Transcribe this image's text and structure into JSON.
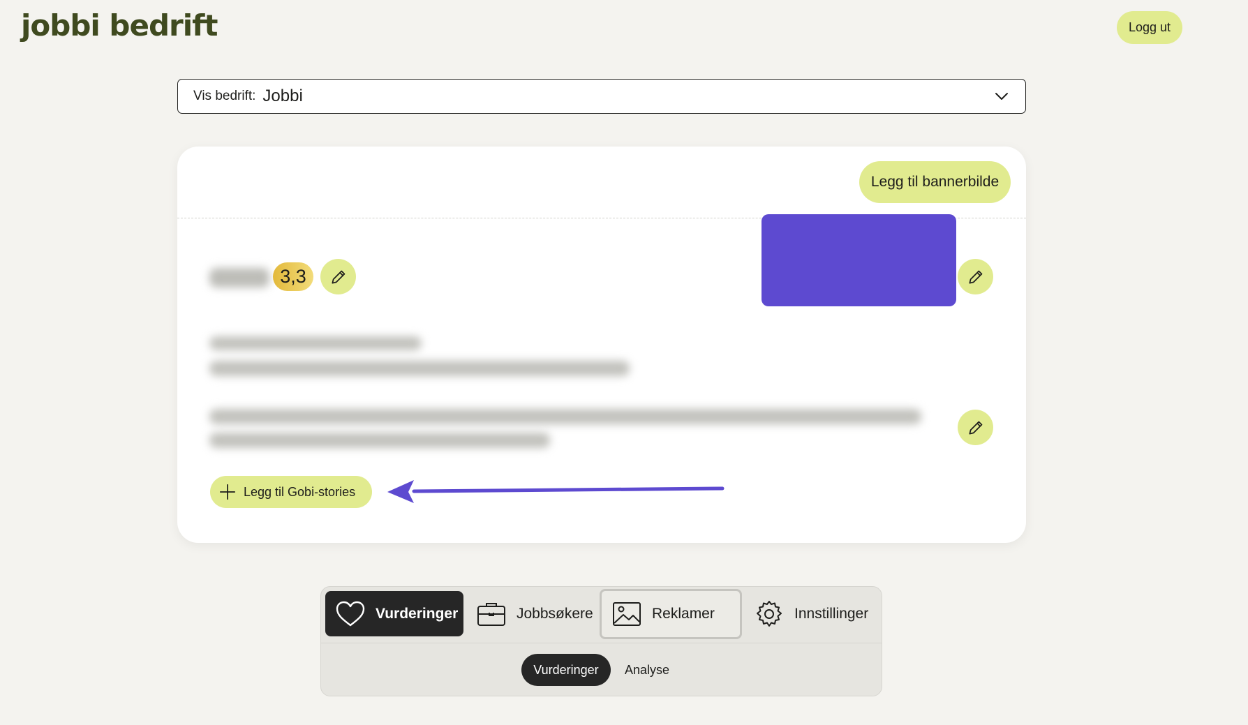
{
  "header": {
    "logo_text": "jobbi bedrift",
    "logout_label": "Logg ut"
  },
  "company_select": {
    "label": "Vis bedrift:",
    "value": "Jobbi"
  },
  "profile_card": {
    "banner_button_label": "Legg til bannerbilde",
    "rating": "3,3",
    "stories_button_label": "Legg til Gobi-stories",
    "logo_color": "#5d4ad0"
  },
  "nav": {
    "tabs": [
      {
        "label": "Vurderinger",
        "icon": "heart-icon"
      },
      {
        "label": "Jobbsøkere",
        "icon": "briefcase-icon"
      },
      {
        "label": "Reklamer",
        "icon": "image-icon"
      },
      {
        "label": "Innstillinger",
        "icon": "gear-icon"
      }
    ],
    "subtabs": [
      {
        "label": "Vurderinger"
      },
      {
        "label": "Analyse"
      }
    ]
  },
  "colors": {
    "accent": "#e1eb8f",
    "dark": "#262626",
    "logo_green": "#3f4a1f",
    "arrow": "#5d4ad0"
  }
}
